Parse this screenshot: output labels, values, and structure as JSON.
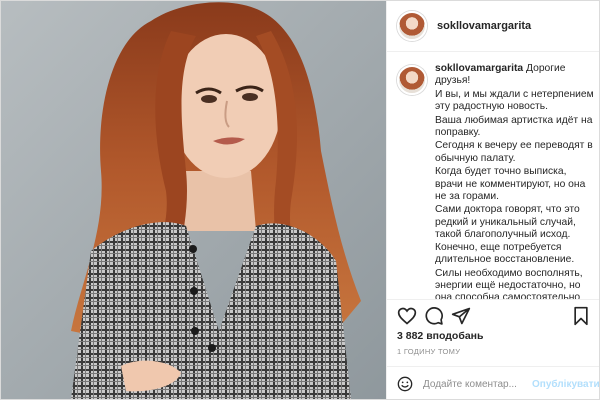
{
  "header": {
    "username": "sokllovamargarita"
  },
  "caption": {
    "username": "sokllovamargarita",
    "lines": [
      "Дорогие друзья!",
      "И вы, и мы ждали с нетерпением эту радостную новость.",
      "Ваша любимая артистка идёт на поправку.",
      "Сегодня к вечеру ее переводят в обычную палату.",
      "Когда будет точно выписка, врачи не комментируют, но она не за горами.",
      "Сами доктора говорят, что это редкий и уникальный случай, такой благополучный исход. Конечно, еще потребуется длительное восстановление.",
      "Силы необходимо восполнять, энергии ещё недостаточно, но она способна самостоятельно ходить,"
    ]
  },
  "actions": {
    "icons": [
      "heart-icon",
      "comment-icon",
      "share-icon",
      "bookmark-icon"
    ],
    "likes": "3 882 вподобань",
    "time": "1 годину тому"
  },
  "comment_box": {
    "placeholder": "Додайте коментар...",
    "post_label": "Опублікувати"
  },
  "colors": {
    "accent": "#0095f6",
    "post_disabled": "#b2dffc",
    "border": "#dbdbdb"
  }
}
